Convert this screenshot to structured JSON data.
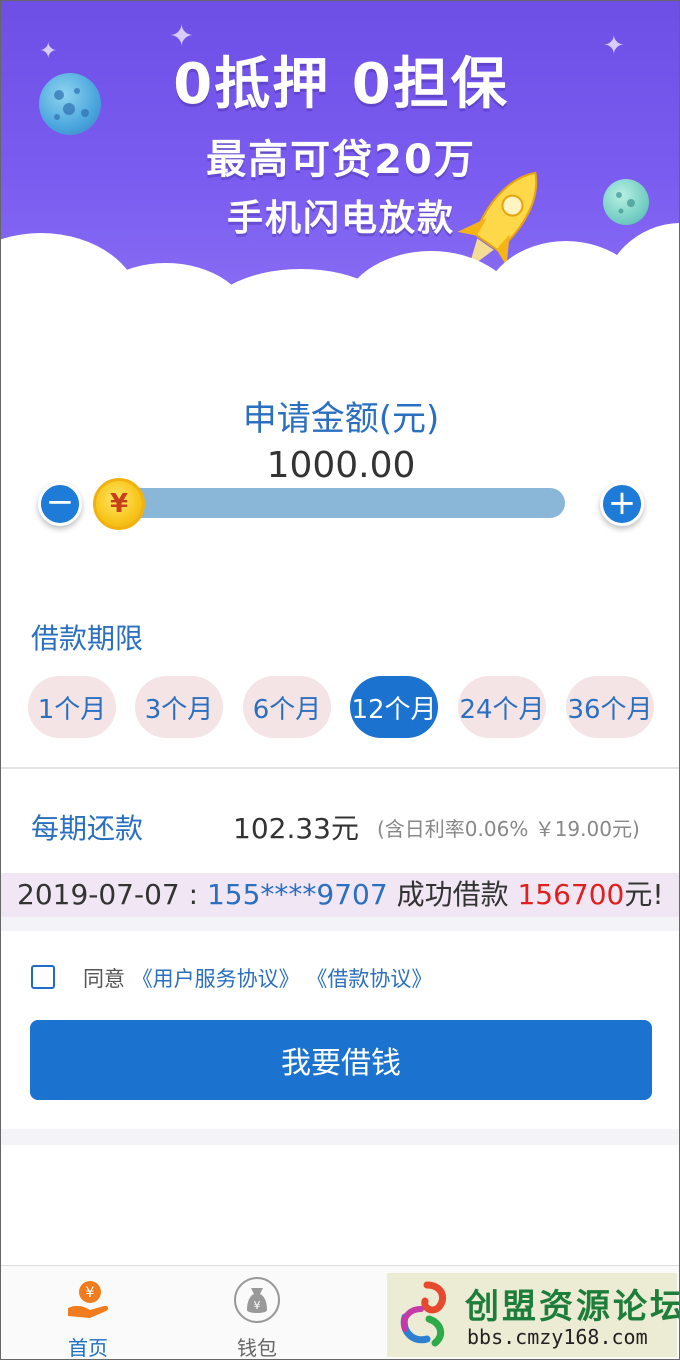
{
  "banner": {
    "line1": "0抵押  0担保",
    "line2": "最高可贷20万",
    "line3": "手机闪电放款"
  },
  "amount": {
    "label": "申请金额(元)",
    "value": "1000.00",
    "knob_symbol": "¥",
    "slider_fraction": 0.0,
    "minus_symbol": "−",
    "plus_symbol": "+"
  },
  "term": {
    "label": "借款期限",
    "options": [
      "1个月",
      "3个月",
      "6个月",
      "12个月",
      "24个月",
      "36个月"
    ],
    "selected": "12个月"
  },
  "repayment": {
    "label": "每期还款",
    "value": "102.33元",
    "note": "(含日利率0.06% ￥19.00元)"
  },
  "marquee": {
    "date": "2019-07-07 : ",
    "phone": "155****9707",
    "text": " 成功借款 ",
    "amount": "156700",
    "suffix": "元!"
  },
  "agreement": {
    "prefix": "同意",
    "link1": "《用户服务协议》",
    "link2": "《借款协议》"
  },
  "borrow_button": "我要借钱",
  "nav": {
    "home": "首页",
    "wallet": "钱包"
  },
  "watermark": {
    "title": "创盟资源论坛",
    "url": "bbs.cmzy168.com"
  },
  "colors": {
    "primary": "#1b73cf",
    "link": "#2a6fc0",
    "highlight": "#e0201f",
    "banner": "#7a5cf0",
    "nav_active": "#f07c1e"
  }
}
